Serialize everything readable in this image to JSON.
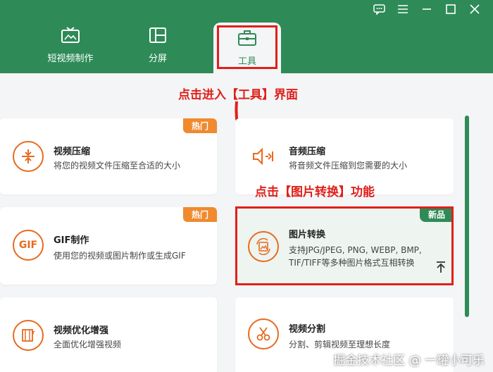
{
  "colors": {
    "header": "#2e8b57",
    "accent": "#e86a1f",
    "annotation": "#e0201a"
  },
  "window_controls": {
    "feedback_icon": "chat-icon",
    "menu_icon": "menu-icon",
    "minimize_icon": "minimize-icon",
    "maximize_icon": "maximize-icon",
    "close_icon": "close-icon"
  },
  "tabs": [
    {
      "label": "短视频制作",
      "icon": "tv-icon"
    },
    {
      "label": "分屏",
      "icon": "split-screen-icon"
    },
    {
      "label": "工具",
      "icon": "toolbox-icon",
      "active": true
    }
  ],
  "annotations": {
    "top": "点击进入【工具】界面",
    "middle": "点击【图片转换】功能"
  },
  "cards": [
    {
      "title": "视频压缩",
      "desc": "将您的视频文件压缩至合适的大小",
      "badge": "热门"
    },
    {
      "title": "音频压缩",
      "desc": "将音频文件压缩到您需要的大小"
    },
    {
      "title": "GIF制作",
      "desc": "使用您的视频或图片制作或生成GIF",
      "badge": "热门",
      "icon_text": "GIF"
    },
    {
      "title": "图片转换",
      "desc1": "支持JPG/JPEG, PNG, WEBP, BMP,",
      "desc2": "TIF/TIFF等多种图片格式互相转换",
      "badge": "新品"
    },
    {
      "title": "视频优化增强",
      "desc": "全面优化增强视频"
    },
    {
      "title": "视频分割",
      "desc": "分割、剪辑视频至理想长度"
    }
  ],
  "watermark": "掘金技术社区 @ 一罐小可乐"
}
